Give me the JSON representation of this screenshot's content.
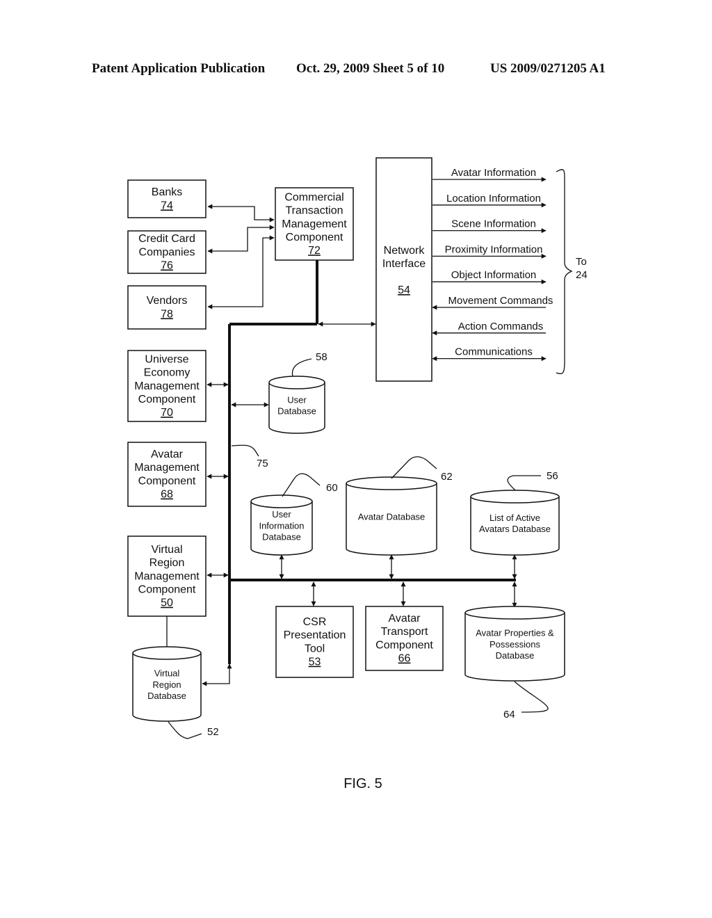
{
  "header": {
    "publication": "Patent Application Publication",
    "date_sheet": "Oct. 29, 2009   Sheet 5 of 10",
    "number": "US 2009/0271205 A1"
  },
  "figure_label": "FIG. 5",
  "boxes": {
    "banks": {
      "lines": [
        "Banks"
      ],
      "ref": "74"
    },
    "credit_card": {
      "lines": [
        "Credit Card",
        "Companies"
      ],
      "ref": "76"
    },
    "vendors": {
      "lines": [
        "Vendors"
      ],
      "ref": "78"
    },
    "commercial": {
      "lines": [
        "Commercial",
        "Transaction",
        "Management",
        "Component"
      ],
      "ref": "72"
    },
    "network": {
      "lines": [
        "Network",
        "Interface"
      ],
      "ref": "54"
    },
    "universe": {
      "lines": [
        "Universe",
        "Economy",
        "Management",
        "Component"
      ],
      "ref": "70"
    },
    "avatar_mgmt": {
      "lines": [
        "Avatar",
        "Management",
        "Component"
      ],
      "ref": "68"
    },
    "virtual_region_mgmt": {
      "lines": [
        "Virtual",
        "Region",
        "Management",
        "Component"
      ],
      "ref": "50"
    },
    "csr": {
      "lines": [
        "CSR",
        "Presentation",
        "Tool"
      ],
      "ref": "53"
    },
    "avatar_transport": {
      "lines": [
        "Avatar",
        "Transport",
        "Component"
      ],
      "ref": "66"
    }
  },
  "databases": {
    "user_db": {
      "lines": [
        "User",
        "Database"
      ],
      "ref": "58"
    },
    "user_info_db": {
      "lines": [
        "User",
        "Information",
        "Database"
      ],
      "ref": "60"
    },
    "avatar_db": {
      "lines": [
        "Avatar Database"
      ],
      "ref": "62"
    },
    "active_avatars_db": {
      "lines": [
        "List of Active",
        "Avatars Database"
      ],
      "ref": "56"
    },
    "virtual_region_db": {
      "lines": [
        "Virtual",
        "Region",
        "Database"
      ],
      "ref": "52"
    },
    "properties_db": {
      "lines": [
        "Avatar Properties &",
        "Possessions",
        "Database"
      ],
      "ref": "64"
    }
  },
  "bus_ref": "75",
  "network_signals": [
    {
      "label": "Avatar Information",
      "direction": "out"
    },
    {
      "label": "Location Information",
      "direction": "out"
    },
    {
      "label": "Scene Information",
      "direction": "out"
    },
    {
      "label": "Proximity Information",
      "direction": "out"
    },
    {
      "label": "Object Information",
      "direction": "out"
    },
    {
      "label": "Movement Commands",
      "direction": "in"
    },
    {
      "label": "Action Commands",
      "direction": "in"
    },
    {
      "label": "Communications",
      "direction": "both"
    }
  ],
  "brace_label": [
    "To",
    "24"
  ]
}
